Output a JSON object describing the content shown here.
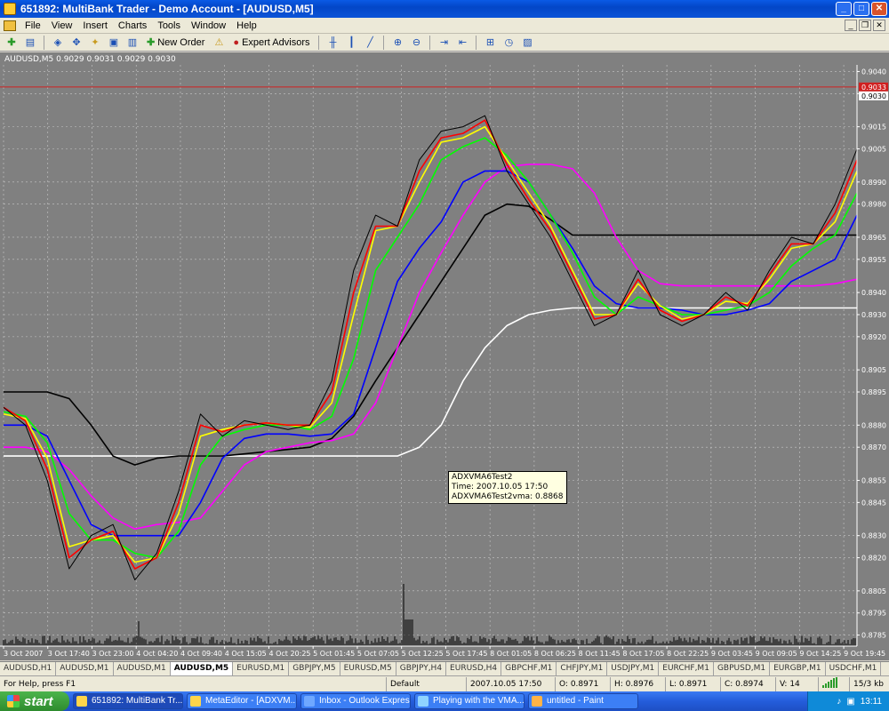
{
  "window": {
    "title": "651892: MultiBank Trader - Demo Account - [AUDUSD,M5]"
  },
  "menu": [
    "File",
    "View",
    "Insert",
    "Charts",
    "Tools",
    "Window",
    "Help"
  ],
  "toolbar": {
    "new_order": "New Order",
    "expert_advisors": "Expert Advisors"
  },
  "chart": {
    "header": "AUDUSD,M5  0.9029 0.9031 0.9029 0.9030",
    "price_labels": [
      "0.9040",
      "0.9030",
      "0.9015",
      "0.9005",
      "0.8990",
      "0.8980",
      "0.8965",
      "0.8955",
      "0.8940",
      "0.8930",
      "0.8920",
      "0.8905",
      "0.8895",
      "0.8880",
      "0.8870",
      "0.8855",
      "0.8845",
      "0.8830",
      "0.8820",
      "0.8805",
      "0.8795",
      "0.8785"
    ],
    "current_price_tag": "0.9033",
    "bid_tag": "0.9030",
    "time_labels": [
      "3 Oct 2007",
      "3 Oct 17:40",
      "3 Oct 23:00",
      "4 Oct 04:20",
      "4 Oct 09:40",
      "4 Oct 15:05",
      "4 Oct 20:25",
      "5 Oct 01:45",
      "5 Oct 07:05",
      "5 Oct 12:25",
      "5 Oct 17:45",
      "8 Oct 01:05",
      "8 Oct 06:25",
      "8 Oct 11:45",
      "8 Oct 17:05",
      "8 Oct 22:25",
      "9 Oct 03:45",
      "9 Oct 09:05",
      "9 Oct 14:25",
      "9 Oct 19:45"
    ],
    "tooltip": [
      "ADXVMA6Test2",
      "Time: 2007.10.05 17:50",
      "ADXVMA6Test2vma: 0.8868"
    ]
  },
  "chart_data": {
    "type": "line",
    "title": "AUDUSD,M5",
    "ylim": [
      0.878,
      0.9043
    ],
    "y_ticks": [
      0.904,
      0.903,
      0.9015,
      0.9005,
      0.899,
      0.898,
      0.8965,
      0.8955,
      0.894,
      0.893,
      0.892,
      0.8905,
      0.8895,
      0.888,
      0.887,
      0.8855,
      0.8845,
      0.883,
      0.882,
      0.8805,
      0.8795,
      0.8785
    ],
    "x_labels": [
      "3 Oct 2007",
      "3 Oct 17:40",
      "3 Oct 23:00",
      "4 Oct 04:20",
      "4 Oct 09:40",
      "4 Oct 15:05",
      "4 Oct 20:25",
      "5 Oct 01:45",
      "5 Oct 07:05",
      "5 Oct 12:25",
      "5 Oct 17:45",
      "8 Oct 01:05",
      "8 Oct 06:25",
      "8 Oct 11:45",
      "8 Oct 17:05",
      "8 Oct 22:25",
      "9 Oct 03:45",
      "9 Oct 09:05",
      "9 Oct 14:25",
      "9 Oct 19:45"
    ],
    "horizontal_line": 0.9033,
    "series": [
      {
        "color": "#000000",
        "values": [
          0.8888,
          0.888,
          0.8855,
          0.8815,
          0.883,
          0.8835,
          0.881,
          0.8822,
          0.885,
          0.8885,
          0.8875,
          0.8882,
          0.888,
          0.8878,
          0.888,
          0.89,
          0.895,
          0.8975,
          0.897,
          0.9,
          0.9013,
          0.9015,
          0.902,
          0.8995,
          0.898,
          0.8965,
          0.8945,
          0.8925,
          0.893,
          0.895,
          0.893,
          0.8925,
          0.893,
          0.894,
          0.8932,
          0.895,
          0.8965,
          0.8962,
          0.898,
          0.9005
        ]
      },
      {
        "color": "#ff0000",
        "values": [
          0.8888,
          0.8882,
          0.886,
          0.882,
          0.8828,
          0.8832,
          0.8815,
          0.882,
          0.8845,
          0.888,
          0.8877,
          0.888,
          0.8881,
          0.888,
          0.888,
          0.8895,
          0.894,
          0.897,
          0.897,
          0.8995,
          0.901,
          0.9012,
          0.9018,
          0.8998,
          0.8982,
          0.8968,
          0.8948,
          0.8928,
          0.893,
          0.8946,
          0.8932,
          0.8927,
          0.893,
          0.8938,
          0.8934,
          0.8948,
          0.8962,
          0.8962,
          0.8976,
          0.9
        ]
      },
      {
        "color": "#ffff00",
        "values": [
          0.8885,
          0.8883,
          0.8865,
          0.8825,
          0.8828,
          0.883,
          0.8818,
          0.882,
          0.884,
          0.8875,
          0.8878,
          0.888,
          0.8881,
          0.888,
          0.8879,
          0.889,
          0.893,
          0.8968,
          0.897,
          0.899,
          0.9008,
          0.901,
          0.9015,
          0.9,
          0.8985,
          0.897,
          0.895,
          0.893,
          0.893,
          0.8944,
          0.8934,
          0.8928,
          0.893,
          0.8936,
          0.8935,
          0.8946,
          0.896,
          0.8962,
          0.8972,
          0.8995
        ]
      },
      {
        "color": "#00ff00",
        "values": [
          0.8886,
          0.8884,
          0.8872,
          0.884,
          0.8828,
          0.8828,
          0.8822,
          0.882,
          0.8832,
          0.8862,
          0.8875,
          0.8878,
          0.888,
          0.888,
          0.8878,
          0.8884,
          0.891,
          0.895,
          0.8965,
          0.898,
          0.9,
          0.9006,
          0.901,
          0.9002,
          0.899,
          0.8975,
          0.8958,
          0.8938,
          0.893,
          0.8938,
          0.8934,
          0.893,
          0.893,
          0.8932,
          0.8934,
          0.894,
          0.8952,
          0.896,
          0.8966,
          0.8985
        ]
      },
      {
        "color": "#0000ff",
        "values": [
          0.888,
          0.888,
          0.8875,
          0.8855,
          0.8835,
          0.883,
          0.883,
          0.883,
          0.883,
          0.8845,
          0.8865,
          0.8874,
          0.8876,
          0.8876,
          0.8875,
          0.8876,
          0.8885,
          0.8915,
          0.8945,
          0.896,
          0.8972,
          0.899,
          0.8995,
          0.8995,
          0.899,
          0.8975,
          0.896,
          0.8943,
          0.8935,
          0.8933,
          0.8933,
          0.8932,
          0.893,
          0.893,
          0.8932,
          0.8935,
          0.8945,
          0.895,
          0.8955,
          0.8975
        ]
      },
      {
        "color": "#ff00ff",
        "values": [
          0.887,
          0.887,
          0.8868,
          0.886,
          0.8848,
          0.8838,
          0.8833,
          0.8835,
          0.8836,
          0.8838,
          0.885,
          0.8862,
          0.8868,
          0.887,
          0.8872,
          0.8873,
          0.8876,
          0.889,
          0.8915,
          0.894,
          0.8958,
          0.8975,
          0.899,
          0.8997,
          0.8998,
          0.8998,
          0.8996,
          0.8985,
          0.8965,
          0.895,
          0.8944,
          0.8943,
          0.8943,
          0.8943,
          0.8943,
          0.8943,
          0.8943,
          0.8943,
          0.8944,
          0.8946
        ]
      },
      {
        "color": "#000000",
        "values": [
          0.8895,
          0.8895,
          0.8895,
          0.8892,
          0.888,
          0.8866,
          0.8862,
          0.8865,
          0.8866,
          0.8866,
          0.8866,
          0.8867,
          0.8868,
          0.8869,
          0.887,
          0.8874,
          0.8884,
          0.89,
          0.8915,
          0.893,
          0.8945,
          0.896,
          0.8975,
          0.898,
          0.8979,
          0.8973,
          0.8966,
          0.8966,
          0.8966,
          0.8966,
          0.8966,
          0.8966,
          0.8966,
          0.8966,
          0.8966,
          0.8966,
          0.8966,
          0.8966,
          0.8966,
          0.8966
        ]
      },
      {
        "color": "#ffffff",
        "values": [
          0.8866,
          0.8866,
          0.8866,
          0.8866,
          0.8866,
          0.8866,
          0.8866,
          0.8866,
          0.8866,
          0.8866,
          0.8866,
          0.8866,
          0.8866,
          0.8866,
          0.8866,
          0.8866,
          0.8866,
          0.8866,
          0.8866,
          0.887,
          0.888,
          0.89,
          0.8915,
          0.8925,
          0.893,
          0.8932,
          0.8933,
          0.8933,
          0.8933,
          0.8933,
          0.8933,
          0.8933,
          0.8933,
          0.8933,
          0.8933,
          0.8933,
          0.8933,
          0.8933,
          0.8933,
          0.8933
        ]
      }
    ]
  },
  "tabs": [
    "AUDUSD,H1",
    "AUDUSD,M1",
    "AUDUSD,M1",
    "AUDUSD,M5",
    "EURUSD,M1",
    "GBPJPY,M5",
    "EURUSD,M5",
    "GBPJPY,H4",
    "EURUSD,H4",
    "GBPCHF,M1",
    "CHFJPY,M1",
    "USDJPY,M1",
    "EURCHF,M1",
    "GBPUSD,M1",
    "EURGBP,M1",
    "USDCHF,M1"
  ],
  "active_tab_index": 3,
  "status": {
    "help": "For Help, press F1",
    "profile": "Default",
    "datetime": "2007.10.05 17:50",
    "open": "O: 0.8971",
    "high": "H: 0.8976",
    "low": "L: 0.8971",
    "close": "C: 0.8974",
    "volume": "V: 14",
    "traffic": "15/3 kb"
  },
  "taskbar": {
    "start": "start",
    "tasks": [
      "651892: MultiBank Tr...",
      "MetaEditor - [ADXVM...",
      "Inbox - Outlook Express",
      "Playing with the VMA...",
      "untitled - Paint"
    ],
    "clock": "13:11"
  }
}
